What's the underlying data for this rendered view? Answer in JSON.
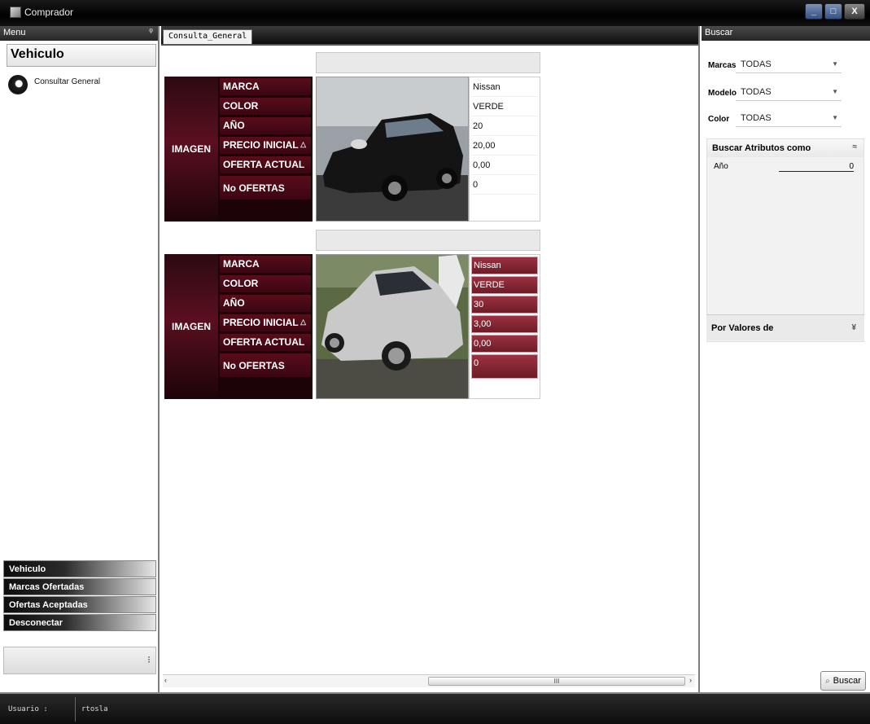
{
  "window": {
    "title": "Comprador",
    "buttons": {
      "minimize": "_",
      "maximize": "□",
      "close": "X"
    }
  },
  "menu_panel": {
    "header": "Menu",
    "pin_glyph": "ᵠ",
    "group_title": "Vehiculo",
    "items": [
      {
        "label": "Consultar General",
        "icon": "consult-icon"
      }
    ],
    "nav_buttons": [
      "Vehiculo",
      "Marcas Ofertadas",
      "Ofertas Aceptadas",
      "Desconectar"
    ],
    "grip_glyph": "⁝"
  },
  "document": {
    "tab_label": "Consulta_General",
    "records": [
      {
        "image_label": "IMAGEN",
        "labels": [
          "MARCA",
          "COLOR",
          "AÑO",
          "PRECIO INICIAL",
          "OFERTA ACTUAL",
          "No OFERTAS"
        ],
        "sort_glyph": "△",
        "values": [
          "Nissan",
          "VERDE",
          "20",
          "20,00",
          "0,00",
          "0"
        ],
        "car_color": "dark"
      },
      {
        "image_label": "IMAGEN",
        "labels": [
          "MARCA",
          "COLOR",
          "AÑO",
          "PRECIO INICIAL",
          "OFERTA ACTUAL",
          "No OFERTAS"
        ],
        "sort_glyph": "△",
        "values": [
          "Nissan",
          "VERDE",
          "30",
          "3,00",
          "0,00",
          "0"
        ],
        "car_color": "silver",
        "selected": true
      }
    ],
    "scroll": {
      "left": "‹",
      "right": "›",
      "thumb": "III"
    }
  },
  "search_panel": {
    "header": "Buscar",
    "filters": [
      {
        "label": "Marcas",
        "value": "TODAS"
      },
      {
        "label": "Modelo",
        "value": "TODAS"
      },
      {
        "label": "Color",
        "value": "TODAS"
      }
    ],
    "attributes_title": "Buscar Atributos como",
    "attributes": [
      {
        "name": "Año",
        "value": "0"
      }
    ],
    "values_title": "Por Valores de",
    "collapse_glyph": "≈",
    "expand_glyph": "¥",
    "search_button": "Buscar"
  },
  "status_bar": {
    "user_label": "Usuario :",
    "user_value": "rtosla"
  },
  "colors": {
    "label_bg": "#4a0914",
    "header_bg": "#262626",
    "highlight": "#8a2838"
  }
}
